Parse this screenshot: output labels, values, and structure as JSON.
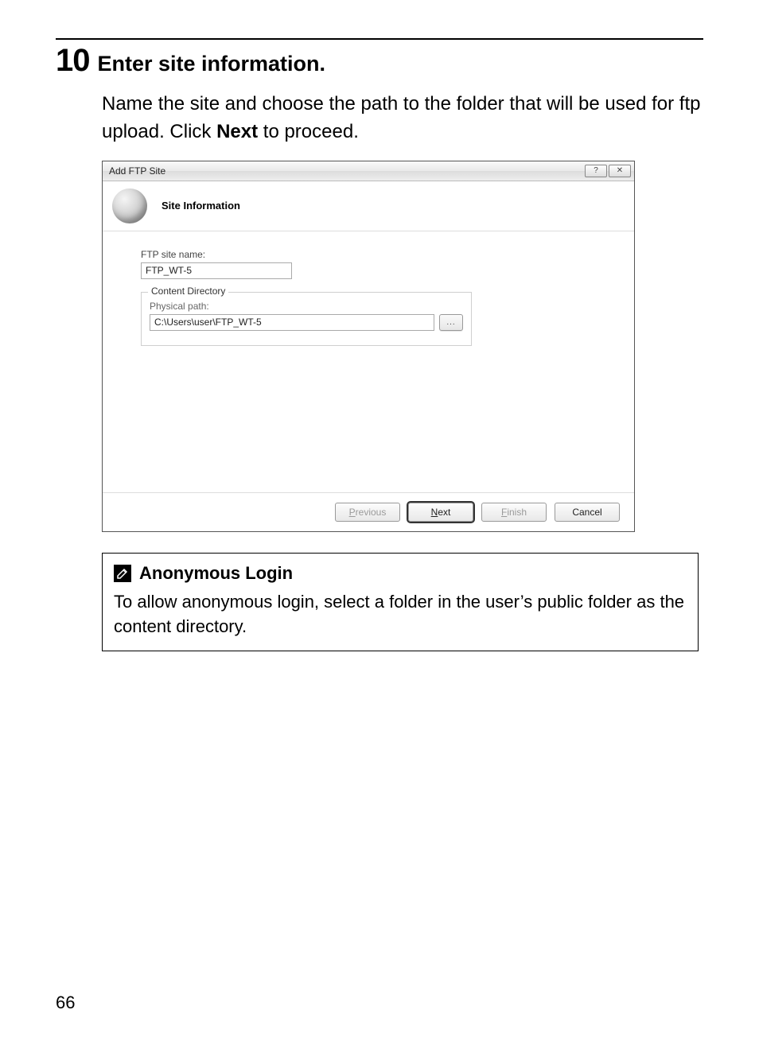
{
  "step": {
    "number": "10",
    "title": "Enter site information.",
    "body_pre": "Name the site and choose the path to the folder that will be used for ftp upload. Click ",
    "body_bold": "Next",
    "body_post": " to proceed."
  },
  "dialog": {
    "window_title": "Add FTP Site",
    "header_title": "Site Information",
    "ftp_site_name_label": "FTP site name:",
    "ftp_site_name_value": "FTP_WT-5",
    "content_directory_legend": "Content Directory",
    "physical_path_label": "Physical path:",
    "physical_path_value": "C:\\Users\\user\\FTP_WT-5",
    "browse_label": "...",
    "buttons": {
      "previous": "Previous",
      "next": "Next",
      "finish": "Finish",
      "cancel": "Cancel"
    },
    "accelerators": {
      "previous": "P",
      "next": "N",
      "finish": "F"
    }
  },
  "note": {
    "title": "Anonymous Login",
    "body": "To allow anonymous login, select a folder in the user’s public folder as the content directory."
  },
  "page_number": "66"
}
